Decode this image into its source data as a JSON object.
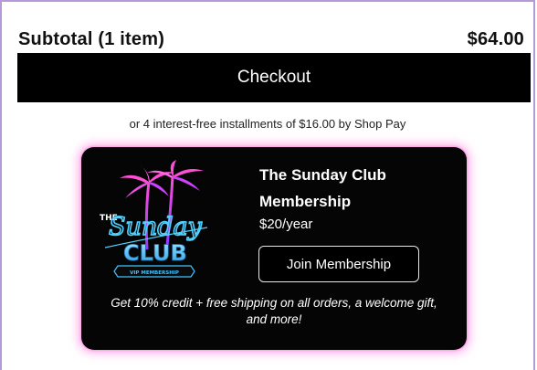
{
  "cart": {
    "subtotal_label": "Subtotal (1 item)",
    "subtotal_value": "$64.00",
    "checkout_label": "Checkout",
    "installments_text": "or 4 interest-free installments of $16.00 by Shop Pay"
  },
  "membership": {
    "title": "The Sunday Club Membership",
    "price": "$20/year",
    "join_label": "Join Membership",
    "perks_text": "Get 10% credit + free shipping on all orders, a welcome gift, and more!",
    "logo": {
      "word_the": "THE",
      "word_sunday": "Sunday",
      "word_club": "CLUB",
      "ribbon_text": "VIP MEMBERSHIP"
    }
  },
  "colors": {
    "accent_pink": "#ff5fd0",
    "accent_blue": "#3fc3ff",
    "frame_border": "#b49ad8"
  }
}
